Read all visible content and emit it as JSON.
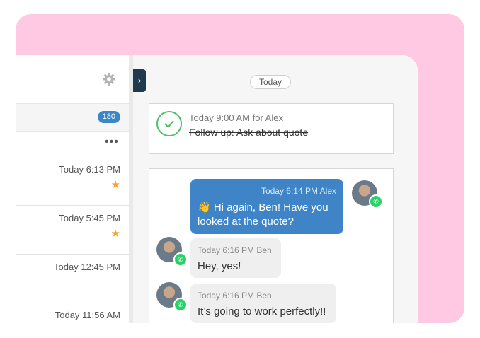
{
  "left_panel": {
    "badge_count": "180",
    "more_label": "•••",
    "items": [
      {
        "time": "Today 6:13 PM",
        "starred": true
      },
      {
        "time": "Today 5:45 PM",
        "starred": true
      },
      {
        "time": "Today 12:45 PM",
        "starred": false
      },
      {
        "time": "Today 11:56 AM",
        "starred": false
      }
    ],
    "star_glyph": "★",
    "icons": {
      "settings": "gear-icon",
      "star": "star-icon"
    }
  },
  "conversation": {
    "collapse_glyph": "›",
    "date_separator": "Today",
    "task": {
      "meta": "Today  9:00 AM  for Alex",
      "title": "Follow up: Ask about quote",
      "icon": "check-circle-icon"
    },
    "messages": [
      {
        "direction": "outgoing",
        "meta": "Today 6:14 PM Alex",
        "text": "👋 Hi again, Ben! Have you looked at the quote?"
      },
      {
        "direction": "incoming",
        "meta": "Today 6:16 PM Ben",
        "text": "Hey, yes!"
      },
      {
        "direction": "incoming",
        "meta": "Today 6:16 PM Ben",
        "text": "It’s going to work perfectly!!"
      }
    ],
    "channel_icon": "whatsapp-icon"
  },
  "colors": {
    "background_accent": "#ffc8e3",
    "badge": "#3b86c6",
    "outgoing_bubble": "#3e84c6",
    "check_green": "#4cc06a",
    "whatsapp_green": "#25d366",
    "star": "#f5a623"
  }
}
